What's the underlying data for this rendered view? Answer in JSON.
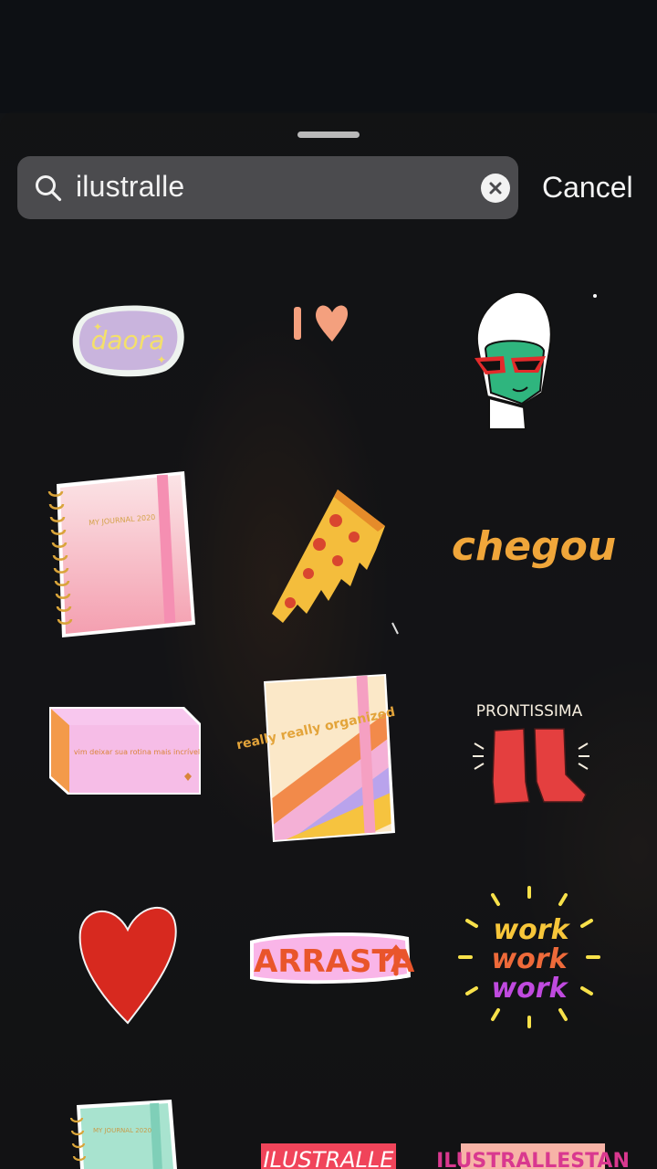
{
  "search": {
    "query": "ilustralle",
    "cancel_label": "Cancel"
  },
  "stickers": [
    {
      "name": "daora-sticker",
      "text": "daora",
      "colors": {
        "fill": "#c9b4dd",
        "text": "#f4e06a"
      }
    },
    {
      "name": "i-love-sticker",
      "text": "I",
      "colors": {
        "fill": "#f4a07e"
      }
    },
    {
      "name": "face-mask-woman-sticker",
      "colors": {
        "face": "#2fb57e",
        "glasses": "#e32b2b"
      }
    },
    {
      "name": "my-journal-pink-sticker",
      "text": "MY JOURNAL 2020",
      "colors": {
        "fill": "#f6b7c0"
      }
    },
    {
      "name": "pizza-slice-sticker",
      "colors": {
        "cheese": "#f4bd3c",
        "pepperoni": "#d9462f"
      }
    },
    {
      "name": "chegou-sticker",
      "text": "chegou",
      "colors": {
        "text": "#f0a63a"
      }
    },
    {
      "name": "pink-box-sticker",
      "text": "vim deixar sua rotina mais incrível",
      "colors": {
        "fill": "#f6bde7"
      }
    },
    {
      "name": "really-organized-notebook-sticker",
      "text": "really really organized",
      "colors": {
        "fill": "#fbe8c8"
      }
    },
    {
      "name": "prontissima-boots-sticker",
      "text": "PRONTISSIMA",
      "colors": {
        "boot": "#e43f3f"
      }
    },
    {
      "name": "red-heart-sticker",
      "colors": {
        "fill": "#d7291f"
      }
    },
    {
      "name": "arrasta-sticker",
      "text": "ARRASTA",
      "colors": {
        "fill": "#f9b5e8",
        "text": "#e9552b"
      }
    },
    {
      "name": "work-work-work-sticker",
      "text": [
        "work",
        "work",
        "work"
      ],
      "colors": {
        "rays": "#f7e14a"
      }
    },
    {
      "name": "my-journal-mint-sticker",
      "text": "MY JOURNAL 2020",
      "colors": {
        "fill": "#a8e3cf"
      }
    },
    {
      "name": "ilustralle-sticker",
      "text": "ILUSTRALLE",
      "colors": {
        "fill": "#f0445a"
      }
    },
    {
      "name": "ilustrallestan-sticker",
      "text": "ILUSTRALLESTAN",
      "colors": {
        "fill": "#f7b3a7"
      }
    }
  ]
}
